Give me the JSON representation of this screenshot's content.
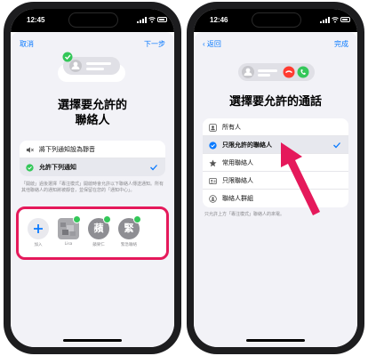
{
  "left_phone": {
    "status": {
      "time": "12:45"
    },
    "nav": {
      "cancel": "取消",
      "next": "下一步"
    },
    "title_line1": "選擇要允許的",
    "title_line2": "聯絡人",
    "options": [
      {
        "label": "將下列通知設為靜音",
        "icon": "speaker-muted-icon",
        "selected": false
      },
      {
        "label": "允許下列通知",
        "icon": "checkmark-circle-icon",
        "selected": true
      }
    ],
    "note": "「開啟」過後選擇「專注模式」開啟時會允許以下聯絡人傳送通知。所有其他聯絡人的通知將被靜音，並保留在您的「通知中心」。",
    "chooser": {
      "add_label": "加入",
      "contacts": [
        {
          "label": "Lisa",
          "initial": "",
          "color": "#8e8e93"
        },
        {
          "label": "蘋果仁",
          "initial": "蘋",
          "color": "#8e8e93"
        },
        {
          "label": "緊急聯絡",
          "initial": "緊",
          "color": "#8e8e93"
        }
      ]
    }
  },
  "right_phone": {
    "status": {
      "time": "12:46"
    },
    "nav": {
      "back": "返回",
      "done": "完成"
    },
    "title": "選擇要允許的通話",
    "options": [
      {
        "label": "所有人",
        "icon": "person-icon",
        "selected": false
      },
      {
        "label": "只限允許的聯絡人",
        "icon": "checkmark-circle-icon",
        "selected": true
      },
      {
        "label": "常用聯絡人",
        "icon": "star-icon",
        "selected": false
      },
      {
        "label": "只限聯絡人",
        "icon": "contacts-card-icon",
        "selected": false
      },
      {
        "label": "聯絡人群組",
        "icon": "group-icon",
        "selected": false
      }
    ],
    "note": "只允許上方「專注模式」聯絡人的來電。"
  },
  "colors": {
    "accent": "#0a7aff",
    "highlight": "#e5195b",
    "green": "#34c759",
    "red": "#ff3b30"
  }
}
